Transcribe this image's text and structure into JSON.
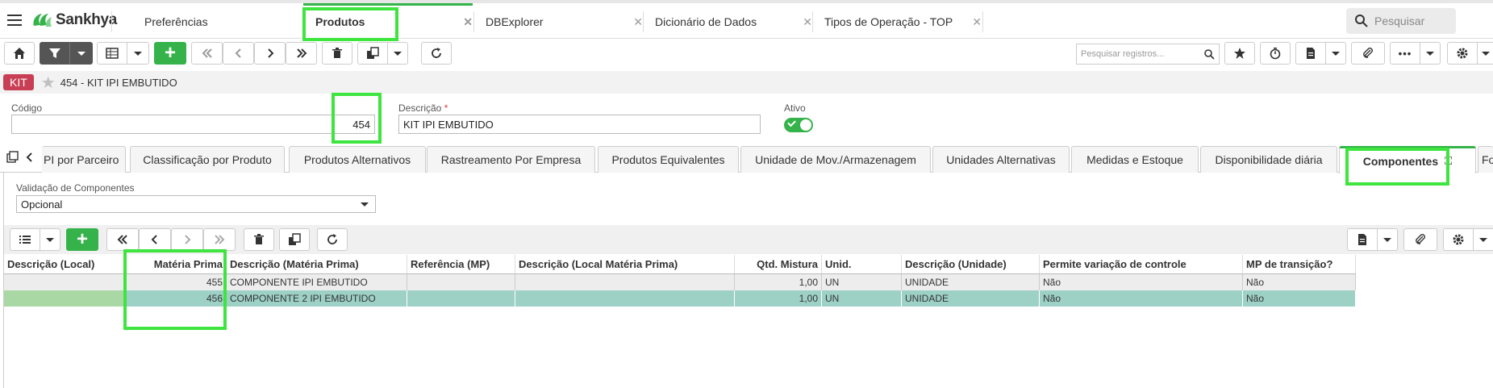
{
  "topbar": {
    "brand": "Sankhya",
    "tabs": [
      {
        "label": "Preferências"
      },
      {
        "label": "Produtos"
      },
      {
        "label": "DBExplorer"
      },
      {
        "label": "Dicionário de Dados"
      },
      {
        "label": "Tipos de Operação - TOP"
      }
    ],
    "search_placeholder": "Pesquisar"
  },
  "toolbar": {
    "search_placeholder": "Pesquisar registros...",
    "add_label": "+"
  },
  "record": {
    "badge": "KIT",
    "title": "454 - KIT IPI EMBUTIDO"
  },
  "form": {
    "codigo_label": "Código",
    "codigo_value": "454",
    "descricao_label": "Descrição",
    "descricao_required": "*",
    "descricao_value": "KIT IPI EMBUTIDO",
    "ativo_label": "Ativo",
    "ativo_value": true
  },
  "subtabs": [
    {
      "label": "PI por Parceiro"
    },
    {
      "label": "Classificação por Produto"
    },
    {
      "label": "Produtos Alternativos"
    },
    {
      "label": "Rastreamento Por Empresa"
    },
    {
      "label": "Produtos Equivalentes"
    },
    {
      "label": "Unidade de Mov./Armazenagem"
    },
    {
      "label": "Unidades Alternativas"
    },
    {
      "label": "Medidas e Estoque"
    },
    {
      "label": "Disponibilidade diária"
    },
    {
      "label": "Componentes"
    },
    {
      "label": "For"
    }
  ],
  "componentes": {
    "validacao_label": "Validação de Componentes",
    "validacao_value": "Opcional",
    "add_label": "+",
    "columns": [
      "Descrição (Local)",
      "Matéria Prima",
      "Descrição (Matéria Prima)",
      "Referência (MP)",
      "Descrição (Local Matéria Prima)",
      "Qtd. Mistura",
      "Unid.",
      "Descrição (Unidade)",
      "Permite variação de controle",
      "MP de transição?"
    ],
    "rows": [
      [
        "",
        "455",
        "COMPONENTE IPI EMBUTIDO",
        "",
        "",
        "1,00",
        "UN",
        "UNIDADE",
        "Não",
        "Não"
      ],
      [
        "",
        "456",
        "COMPONENTE 2 IPI EMBUTIDO",
        "",
        "",
        "1,00",
        "UN",
        "UNIDADE",
        "Não",
        "Não"
      ]
    ]
  },
  "colors": {
    "brand_green": "#35b34a",
    "kit_badge": "#c83e54",
    "selected_row": "#9ed1c6",
    "highlight": "#3ee53e"
  }
}
